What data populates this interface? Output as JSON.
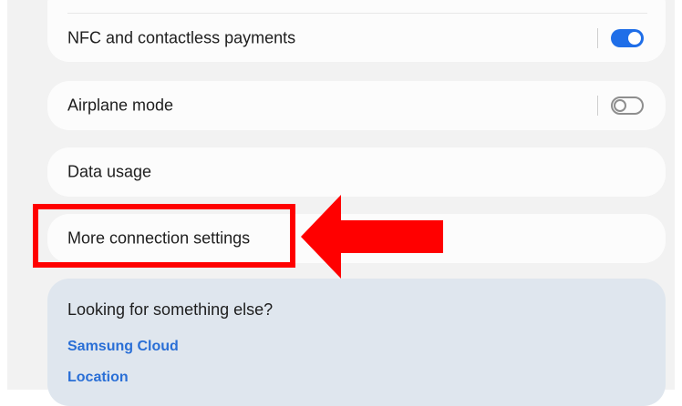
{
  "settings": {
    "nfc": {
      "label": "NFC and contactless payments",
      "enabled": true
    },
    "airplane": {
      "label": "Airplane mode",
      "enabled": false
    },
    "data_usage": {
      "label": "Data usage"
    },
    "more_connection": {
      "label": "More connection settings"
    }
  },
  "suggestions": {
    "heading": "Looking for something else?",
    "links": [
      "Samsung Cloud",
      "Location"
    ]
  },
  "annotation": {
    "highlight_color": "#ff0000",
    "arrow_color": "#ff0000",
    "arrow_direction": "left"
  },
  "colors": {
    "toggle_on": "#1f6ee8",
    "link": "#2a6fd6",
    "background": "#f2f2f2",
    "card": "#fcfcfc",
    "suggest_card": "#dfe6ee"
  }
}
